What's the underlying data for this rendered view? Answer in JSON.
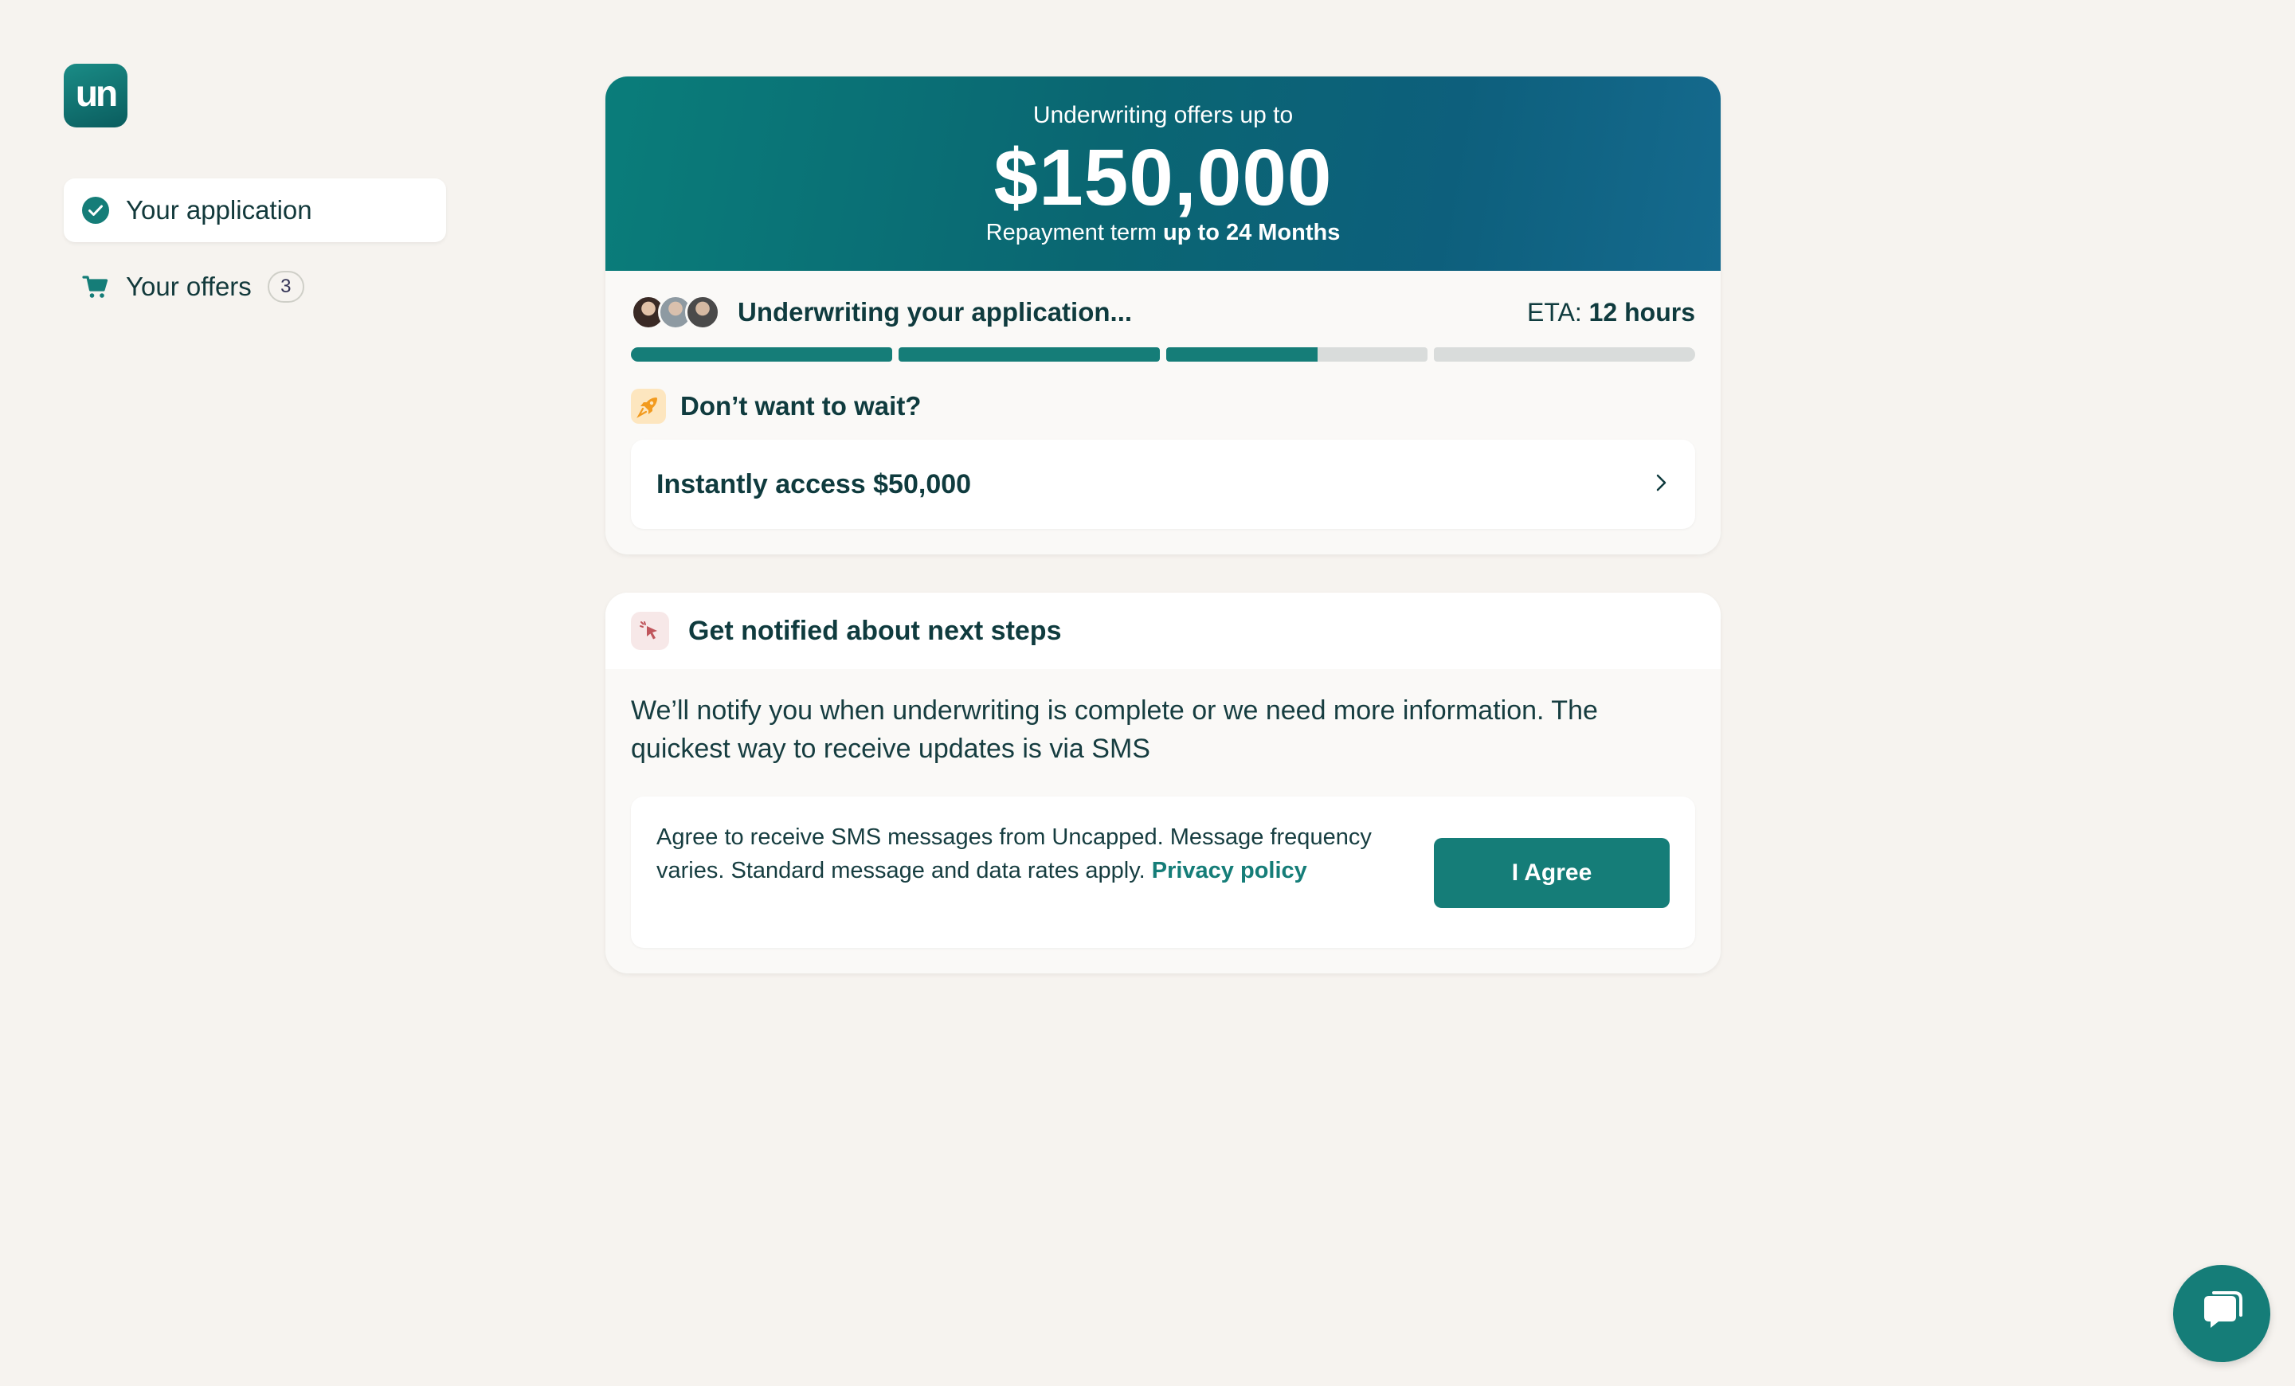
{
  "logo": {
    "text": "un"
  },
  "sidebar": {
    "items": [
      {
        "label": "Your application",
        "icon": "check-circle-icon"
      },
      {
        "label": "Your offers",
        "icon": "cart-icon",
        "badge": "3"
      }
    ]
  },
  "hero": {
    "subtitle": "Underwriting offers up to",
    "amount": "$150,000",
    "term_prefix": "Repayment term",
    "term_value": "up to 24 Months"
  },
  "status": {
    "title": "Underwriting your application...",
    "eta_label": "ETA:",
    "eta_value": "12 hours",
    "progress_segments": [
      1.0,
      1.0,
      0.58,
      0.0
    ]
  },
  "wait": {
    "title": "Don’t want to wait?",
    "action_label": "Instantly access $50,000"
  },
  "notify": {
    "title": "Get notified about next steps",
    "body": "We’ll notify you when underwriting is complete or we need more information. The quickest way to receive updates is via SMS",
    "sms_consent": "Agree to receive SMS messages from Uncapped. Message frequency varies. Standard message and data rates apply.",
    "privacy_link": "Privacy policy",
    "agree_label": "I Agree"
  },
  "colors": {
    "accent": "#157d78",
    "background": "#f6f3ef",
    "text": "#0f3b3e"
  }
}
